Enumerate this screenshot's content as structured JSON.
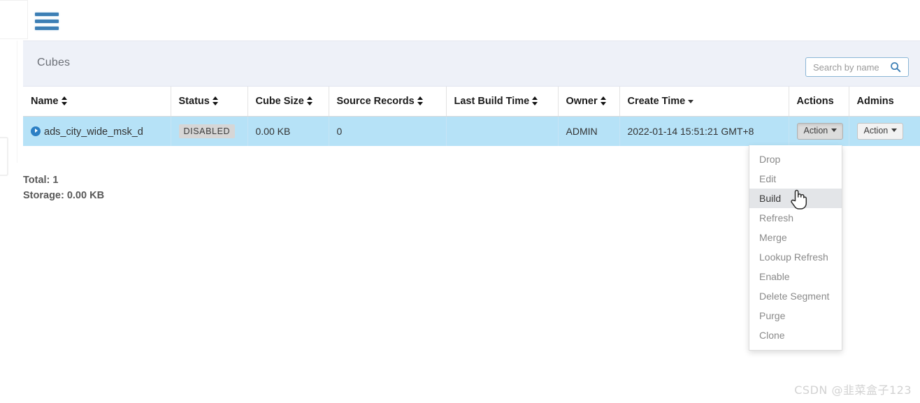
{
  "topbar": {
    "menu_icon": "hamburger-icon"
  },
  "panel": {
    "title": "Cubes",
    "search": {
      "placeholder": "Search by name",
      "value": "",
      "icon": "search-icon"
    }
  },
  "table": {
    "columns": [
      {
        "label": "Name",
        "sort": "both"
      },
      {
        "label": "Status",
        "sort": "both"
      },
      {
        "label": "Cube Size",
        "sort": "both"
      },
      {
        "label": "Source Records",
        "sort": "both"
      },
      {
        "label": "Last Build Time",
        "sort": "both"
      },
      {
        "label": "Owner",
        "sort": "both"
      },
      {
        "label": "Create Time",
        "sort": "down"
      },
      {
        "label": "Actions",
        "sort": "none"
      },
      {
        "label": "Admins",
        "sort": "none"
      }
    ],
    "rows": [
      {
        "name": "ads_city_wide_msk_d",
        "status": "DISABLED",
        "cube_size": "0.00 KB",
        "source_records": "0",
        "last_build_time": "",
        "owner": "ADMIN",
        "create_time": "2022-01-14 15:51:21 GMT+8",
        "actions_label": "Action",
        "admins_label": "Action"
      }
    ]
  },
  "dropdown": {
    "items": [
      "Drop",
      "Edit",
      "Build",
      "Refresh",
      "Merge",
      "Lookup Refresh",
      "Enable",
      "Delete Segment",
      "Purge",
      "Clone"
    ],
    "active_index": 2
  },
  "summary": {
    "total": "Total: 1",
    "storage": "Storage: 0.00 KB"
  },
  "watermark": "CSDN @韭菜盒子123",
  "colors": {
    "accent": "#3d7fb5",
    "row_selected": "#b6e2f7",
    "panel_head": "#eef1f8",
    "badge_bg": "#d6d6d6"
  }
}
